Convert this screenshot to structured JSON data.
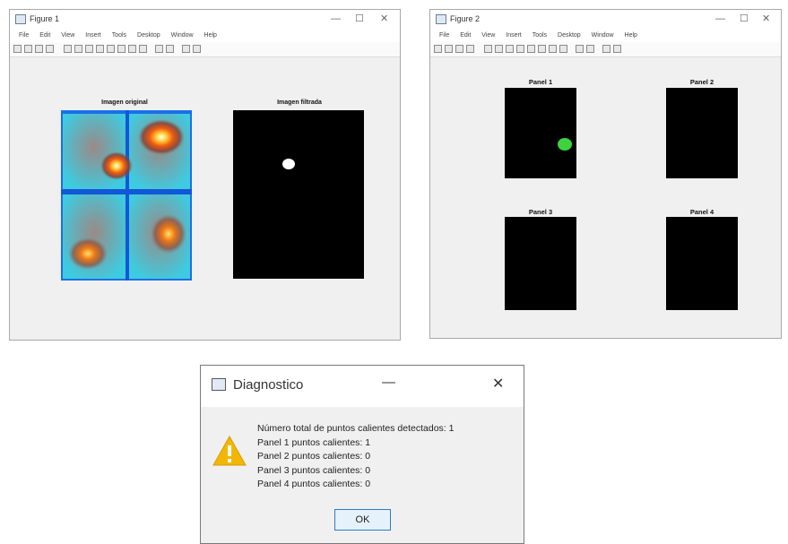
{
  "menu_items": [
    "File",
    "Edit",
    "View",
    "Insert",
    "Tools",
    "Desktop",
    "Window",
    "Help"
  ],
  "figure1": {
    "title": "Figure 1",
    "left_plot_title": "Imagen original",
    "right_plot_title": "Imagen filtrada"
  },
  "figure2": {
    "title": "Figure 2",
    "panels": [
      "Panel 1",
      "Panel 2",
      "Panel 3",
      "Panel 4"
    ]
  },
  "dialog": {
    "title": "Diagnostico",
    "lines": [
      "Número total de puntos calientes detectados: 1",
      "Panel 1 puntos calientes: 1",
      "Panel 2 puntos calientes: 0",
      "Panel 3 puntos calientes: 0",
      "Panel 4 puntos calientes: 0"
    ],
    "ok_label": "OK"
  },
  "colors": {
    "accent": "#2d7cc5",
    "hotspot_filtered": "#ffffff",
    "hotspot_panel": "#3cd43c",
    "warning": "#f2b705"
  }
}
